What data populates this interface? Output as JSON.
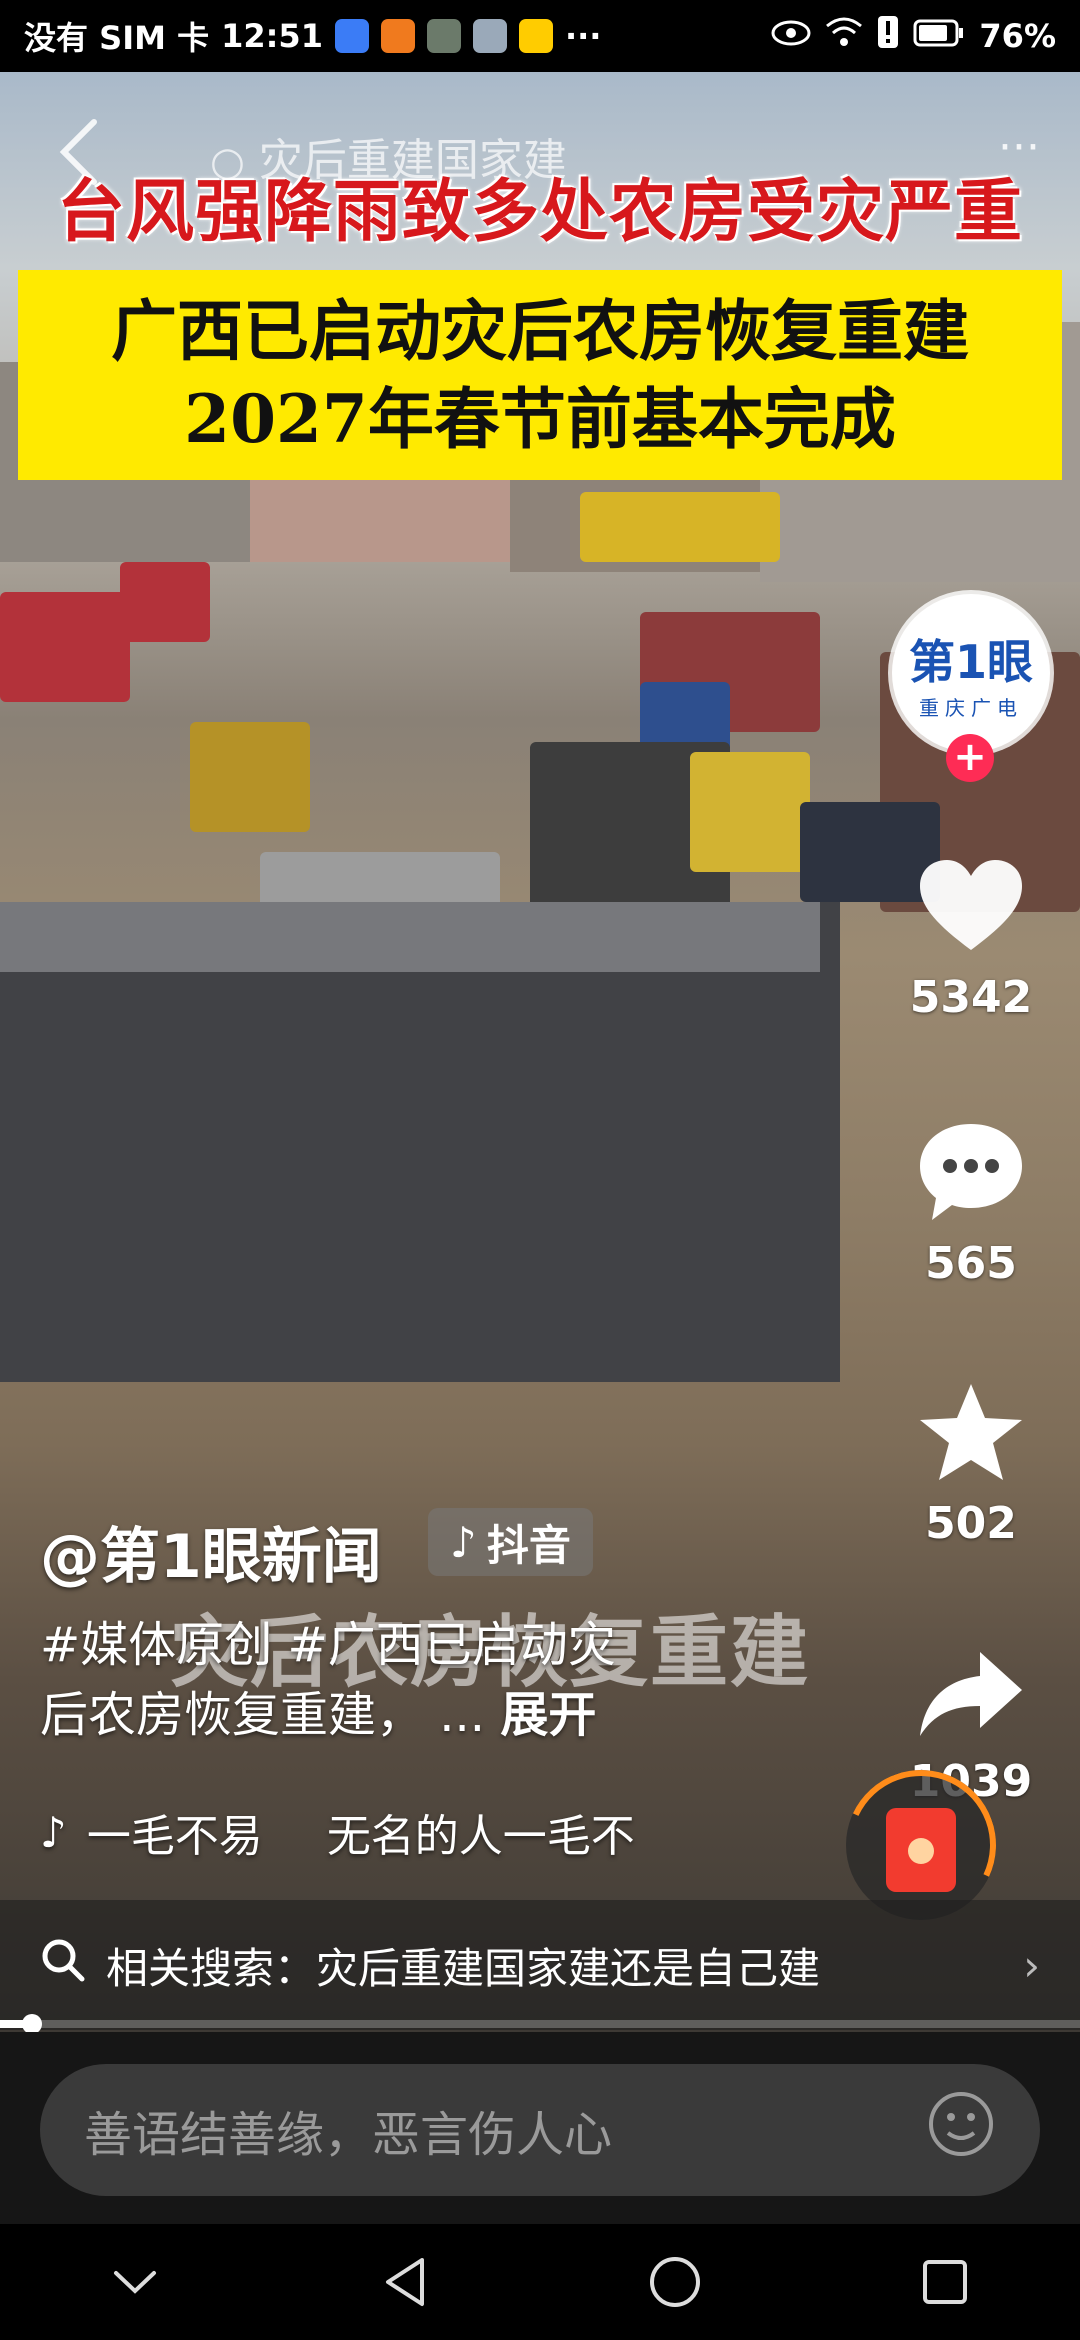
{
  "status_bar": {
    "carrier": "没有 SIM 卡",
    "time": "12:51",
    "overflow": "···",
    "battery": "76%"
  },
  "top_bar": {
    "search_text": "灾后重建国家建",
    "more": "···"
  },
  "video_overlay": {
    "headline": "台风强降雨致多处农房受灾严重",
    "subheadline_line1": "广西已启动灾后农房恢复重建",
    "subheadline_line2": "2027年春节前基本完成",
    "watermark": "灾后农房恢复重建"
  },
  "creator": {
    "avatar_logo_top": "第1眼",
    "avatar_logo_sub": "重庆广电",
    "follow_symbol": "+"
  },
  "actions": {
    "likes": "5342",
    "comments": "565",
    "favorites": "502",
    "shares": "1039"
  },
  "post": {
    "author": "@第1眼新闻",
    "platform_tag": "抖音",
    "description_line1": "#媒体原创 #广西已启动灾",
    "description_line2": "后农房恢复重建，",
    "ellipsis": "...",
    "expand": "展开",
    "music_title": "一毛不易",
    "music_subtitle": "无名的人一毛不"
  },
  "related_search": {
    "label": "相关搜索：灾后重建国家建还是自己建"
  },
  "playback": {
    "progress_fraction": 0.03
  },
  "comment_input": {
    "placeholder": "善语结善缘，恶言伤人心"
  },
  "colors": {
    "accent_red": "#fe2c55",
    "headline_red": "#d7181c",
    "banner_yellow": "#ffea00"
  }
}
